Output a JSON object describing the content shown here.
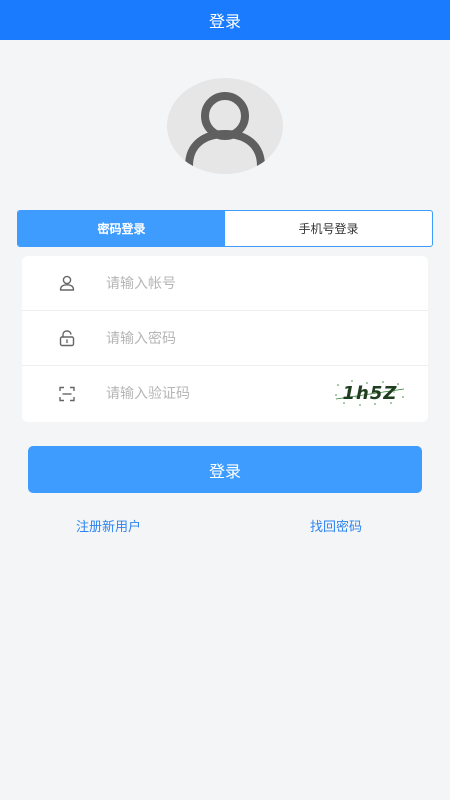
{
  "header": {
    "title": "登录"
  },
  "avatar": {
    "icon": "user-avatar-icon"
  },
  "tabs": [
    {
      "label": "密码登录",
      "active": true
    },
    {
      "label": "手机号登录",
      "active": false
    }
  ],
  "form": {
    "account": {
      "placeholder": "请输入帐号",
      "value": "",
      "icon": "user-icon"
    },
    "password": {
      "placeholder": "请输入密码",
      "value": "",
      "icon": "lock-icon"
    },
    "captcha": {
      "placeholder": "请输入验证码",
      "value": "",
      "icon": "scan-icon",
      "image_text": "1h5Z"
    }
  },
  "login_button": {
    "label": "登录"
  },
  "links": {
    "register": "注册新用户",
    "forgot_password": "找回密码"
  },
  "colors": {
    "primary": "#1a7bff",
    "accent": "#3f9cff",
    "link": "#2d84f0",
    "background": "#f4f5f7"
  }
}
